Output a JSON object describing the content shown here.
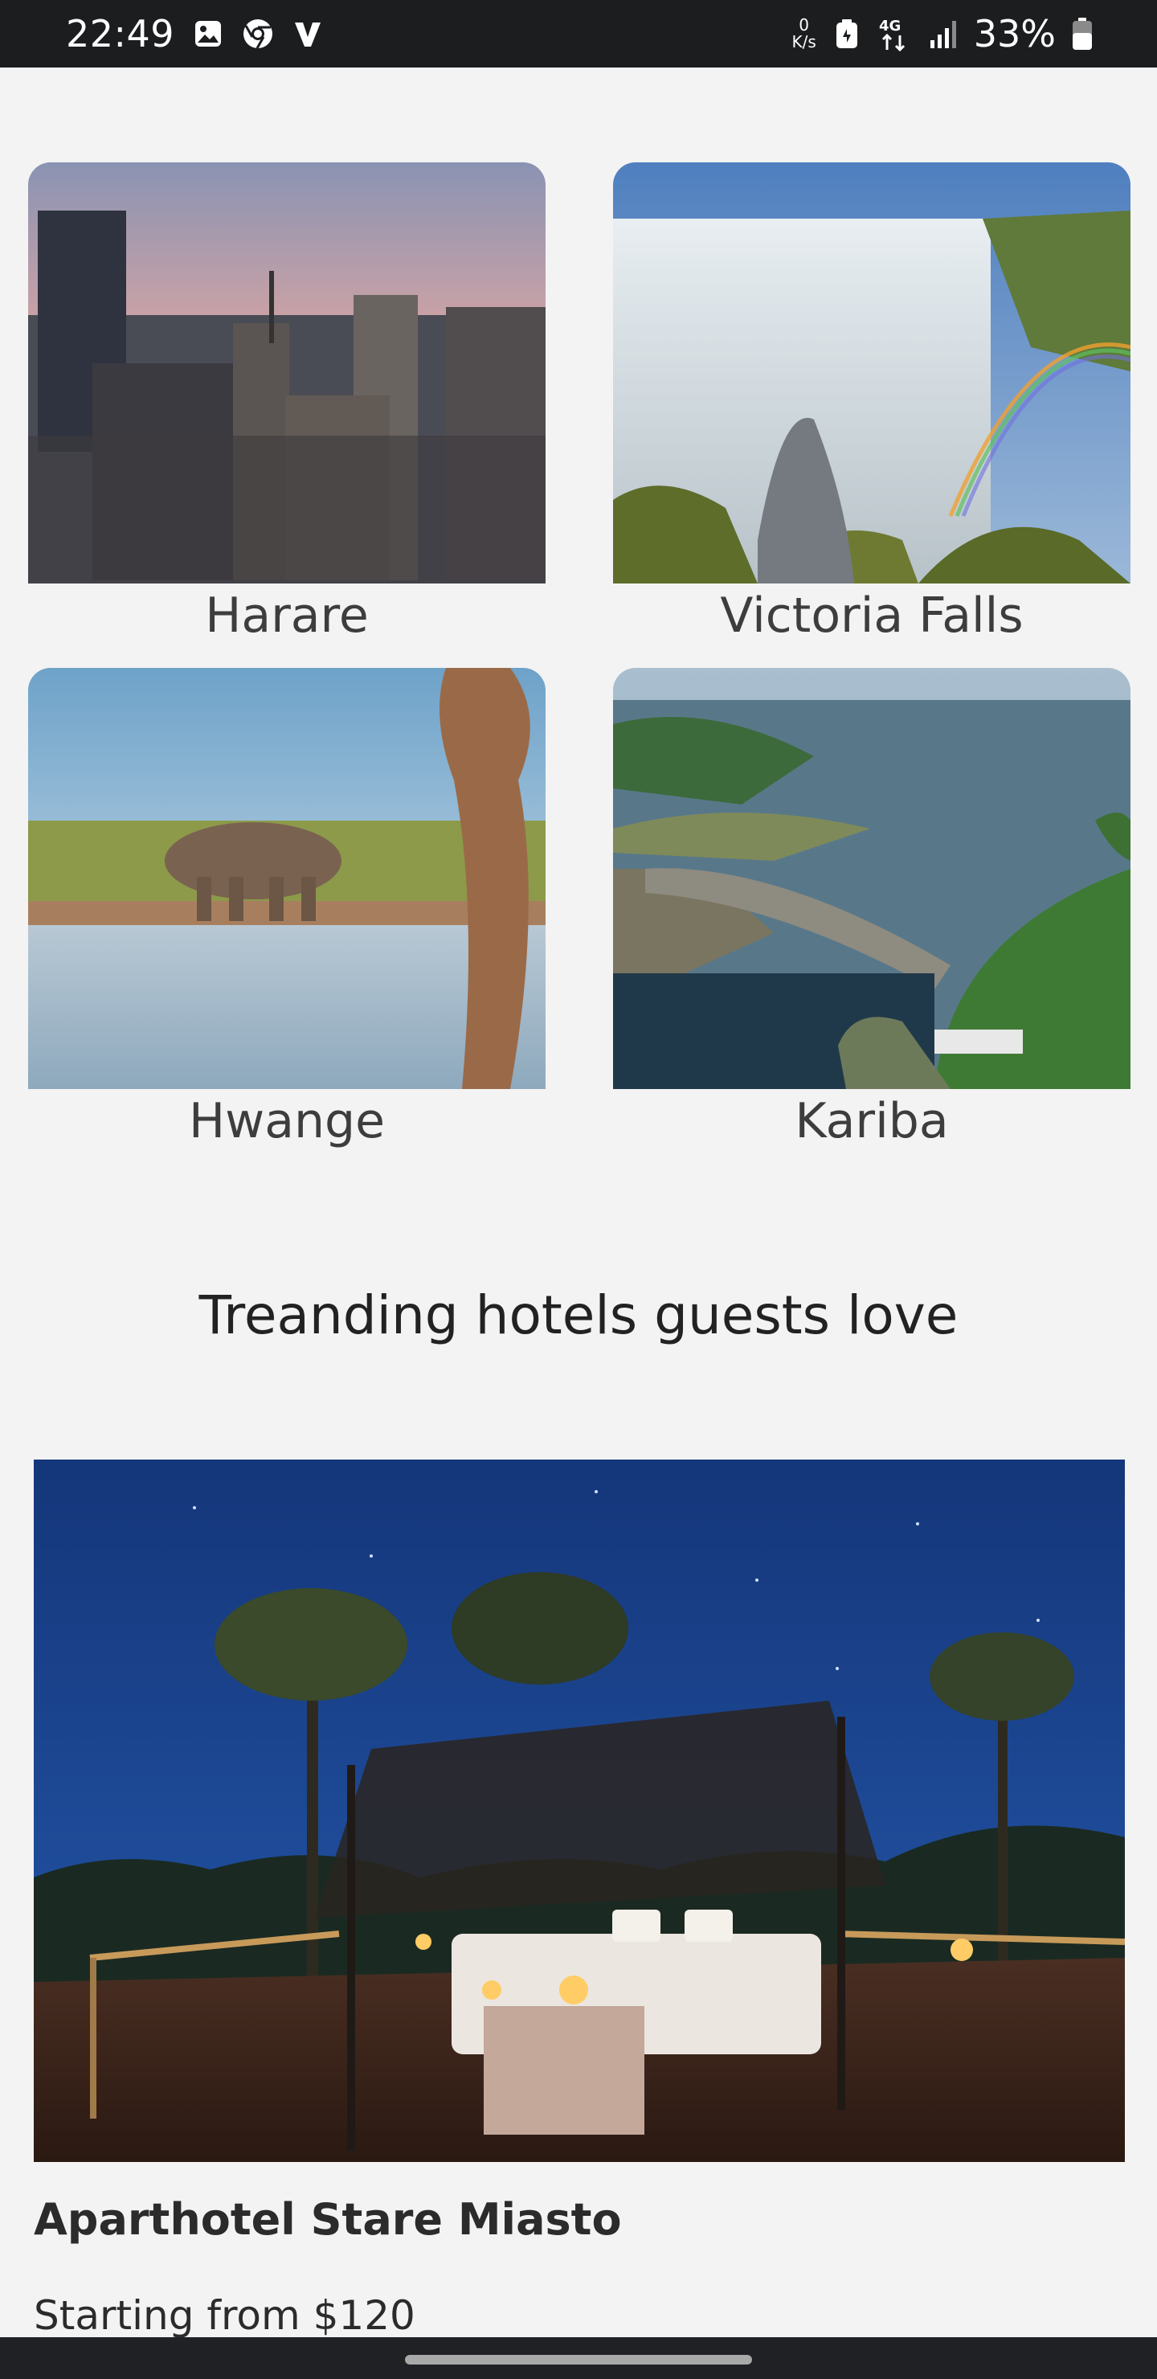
{
  "status_bar": {
    "time": "22:49",
    "net_speed_value": "0",
    "net_speed_unit": "K/s",
    "network_type": "4G",
    "battery_percent": "33%"
  },
  "destinations": [
    {
      "name": "Harare"
    },
    {
      "name": "Victoria Falls"
    },
    {
      "name": "Hwange"
    },
    {
      "name": "Kariba"
    }
  ],
  "trending": {
    "title": "Treanding hotels guests love"
  },
  "hotel": {
    "name": "Aparthotel Stare Miasto",
    "price": "Starting from $120"
  }
}
